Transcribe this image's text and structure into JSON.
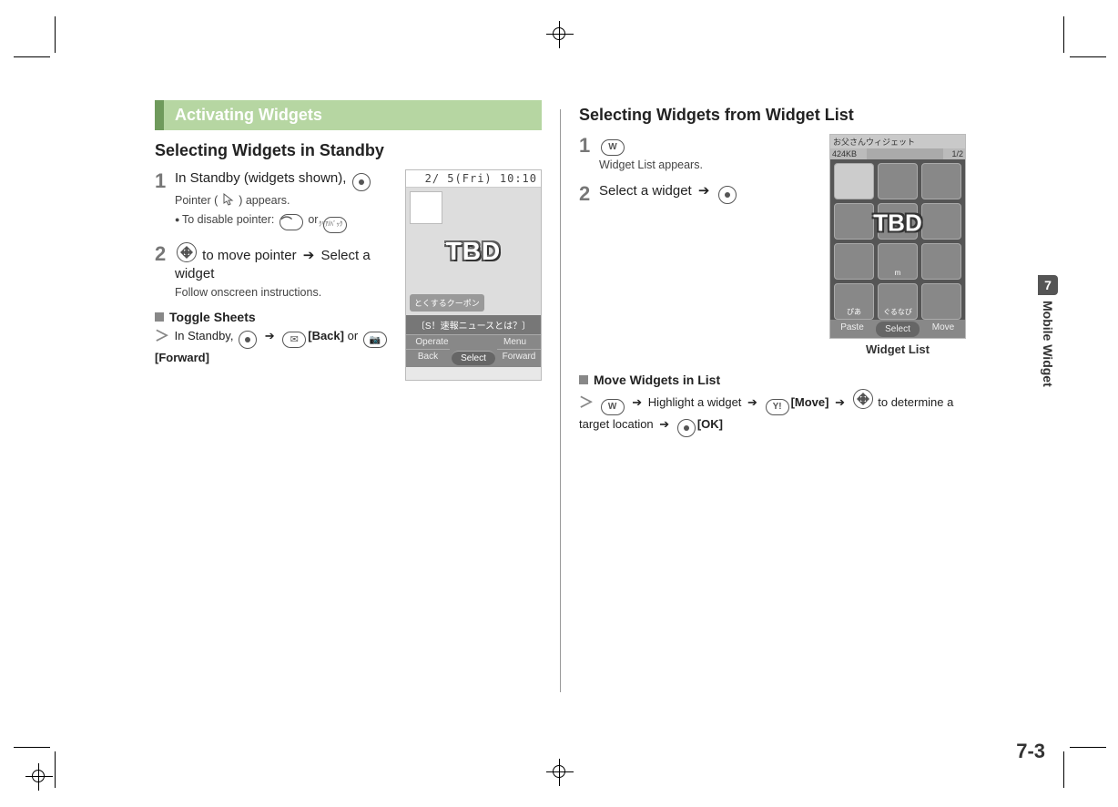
{
  "page": {
    "number": "7-3",
    "chapter_num": "7",
    "chapter_label": "Mobile Widget"
  },
  "left": {
    "section": "Activating Widgets",
    "heading": "Selecting Widgets in Standby",
    "step1": "In Standby (widgets shown),",
    "step1_sub": ") appears.",
    "step1_sub_prefix": "Pointer (",
    "step1_bullet": "To disable pointer:",
    "step1_or": "or",
    "step2a": "to move pointer",
    "step2b": "Select a widget",
    "step2_sub": "Follow onscreen instructions.",
    "toggle_title": "Toggle Sheets",
    "toggle_prefix": "In Standby,",
    "toggle_back": "[Back]",
    "toggle_or": "or",
    "toggle_forward": "[Forward]",
    "shot": {
      "clock": "2/ 5(Fri) 10:10",
      "tbd": "TBD",
      "coupon": "とくするクーポン",
      "newsbar": "〔S！速報ニュースとは？〕",
      "sk_tl": "Operate",
      "sk_tr": "Menu",
      "sk_bl": "Back",
      "sk_bm": "Select",
      "sk_br": "Forward"
    }
  },
  "right": {
    "heading": "Selecting Widgets from Widget List",
    "step1_sub": "Widget List appears.",
    "step2": "Select a widget",
    "shot": {
      "name": "お父さんウィジェット",
      "size": "424KB",
      "page": "1/2",
      "tbd": "TBD",
      "cells": [
        "",
        "",
        "",
        "",
        "",
        "",
        "",
        "m",
        "",
        "ぴあ",
        "ぐるなび",
        ""
      ],
      "sk_l": "Paste",
      "sk_m": "Select",
      "sk_r": "Move",
      "caption": "Widget List"
    },
    "move_title": "Move Widgets in List",
    "move_text1": "Highlight a widget",
    "move_btn": "[Move]",
    "move_text2": "to determine a target location",
    "move_ok": "[OK]"
  }
}
